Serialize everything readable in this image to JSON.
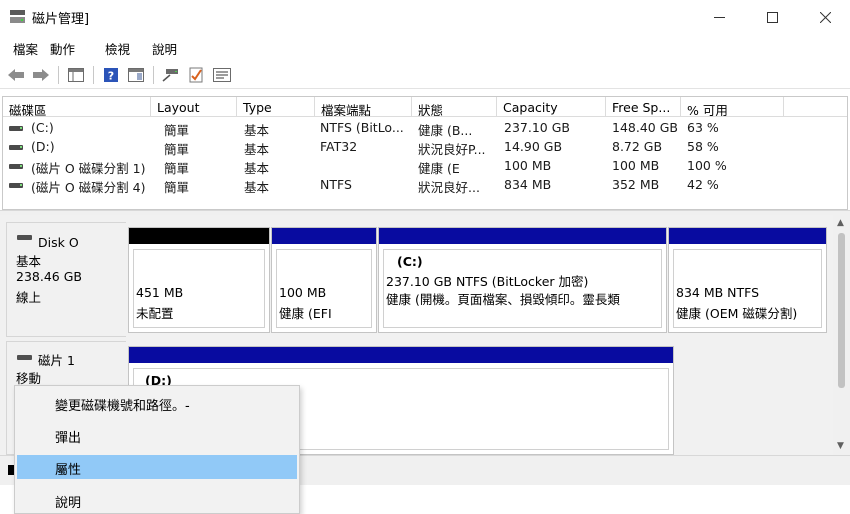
{
  "window": {
    "title": "磁片管理]",
    "controls": {
      "minimize": "minimize-icon",
      "maximize": "maximize-icon",
      "close": "close-icon"
    }
  },
  "menu": [
    "檔案",
    "動作",
    "檢視",
    "說明"
  ],
  "toolbar": {
    "icons": [
      "back-arrow-icon",
      "forward-arrow-icon",
      "console-tree-icon",
      "help-icon",
      "show-pane-icon",
      "connect-icon",
      "check-icon",
      "properties-icon"
    ]
  },
  "volume_list": {
    "columns": [
      "磁碟區",
      "Layout",
      "Type",
      "檔案端點",
      "狀態",
      "Capacity",
      "Free Sp...",
      "% 可用"
    ],
    "rows": [
      {
        "volume": "(C:)",
        "layout": "簡單",
        "type": "基本",
        "fs": "NTFS (BitLo...",
        "status": "健康 (B...",
        "capacity": "237.10 GB",
        "free": "148.40 GB",
        "pct": "63 %"
      },
      {
        "volume": "(D:)",
        "layout": "簡單",
        "type": "基本",
        "fs": "FAT32",
        "status": "狀況良好P...",
        "capacity": "14.90 GB",
        "free": "8.72 GB",
        "pct": "58 %"
      },
      {
        "volume": "(磁片 O 磁碟分割 1)",
        "layout": "簡單",
        "type": "基本",
        "fs": "",
        "status": "健康 (E",
        "capacity": "100 MB",
        "free": "100 MB",
        "pct": "100 %"
      },
      {
        "volume": "(磁片 O 磁碟分割 4)",
        "layout": "簡單",
        "type": "基本",
        "fs": "NTFS",
        "status": "狀況良好...",
        "capacity": "834 MB",
        "free": "352 MB",
        "pct": "42 %"
      }
    ]
  },
  "disks": [
    {
      "name": "Disk O",
      "type": "基本",
      "size": "238.46 GB",
      "state": "線上",
      "partitions": [
        {
          "line1": "451 MB",
          "line2": "未配置",
          "bar": "unallocated"
        },
        {
          "line1": "100 MB",
          "line2": "健康 (EFI",
          "bar": "primary"
        },
        {
          "title": "(C:)",
          "line1": "237.10 GB NTFS (BitLocker 加密)",
          "line2": "健康 (開機。頁面檔案、損毀傾印。靈長類",
          "bar": "primary"
        },
        {
          "line1": "834 MB NTFS",
          "line2": "健康 (OEM 磁碟分割)",
          "bar": "primary"
        }
      ]
    },
    {
      "name": "磁片 1",
      "type": "移動",
      "partitions": [
        {
          "title": "(D:)",
          "bar": "primary"
        }
      ]
    }
  ],
  "context_menu": {
    "items": [
      "變更磁碟機號和路徑。-",
      "彈出",
      "屬性",
      "說明"
    ],
    "highlighted_index": 2
  },
  "colors": {
    "primary_partition": "#080ba0",
    "unallocated": "#000000",
    "highlight": "#91c9f7"
  }
}
